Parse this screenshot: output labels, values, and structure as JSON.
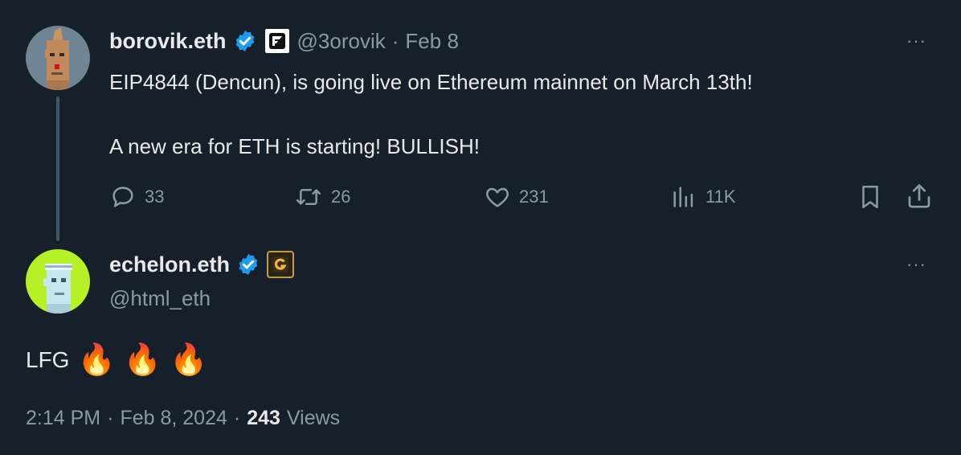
{
  "tweet1": {
    "name": "borovik.eth",
    "handle": "@3orovik",
    "separator": "·",
    "date": "Feb 8",
    "line1": "EIP4844 (Dencun), is going live on Ethereum mainnet on March 13th!",
    "line2": "A new era for ETH is starting! BULLISH!",
    "more": "···",
    "actions": {
      "replies": "33",
      "reposts": "26",
      "likes": "231",
      "views": "11K"
    }
  },
  "tweet2": {
    "name": "echelon.eth",
    "handle": "@html_eth",
    "more": "···",
    "text": "LFG",
    "emoji": "🔥",
    "meta": {
      "time": "2:14 PM",
      "dot1": "·",
      "date": "Feb 8, 2024",
      "dot2": "·",
      "views_count": "243",
      "views_label": "Views"
    }
  },
  "colors": {
    "background": "#15202b",
    "text_primary": "#e7e9ea",
    "text_secondary": "#8b98a5",
    "verified_blue": "#1d9bf0",
    "thread_line": "#425364"
  }
}
